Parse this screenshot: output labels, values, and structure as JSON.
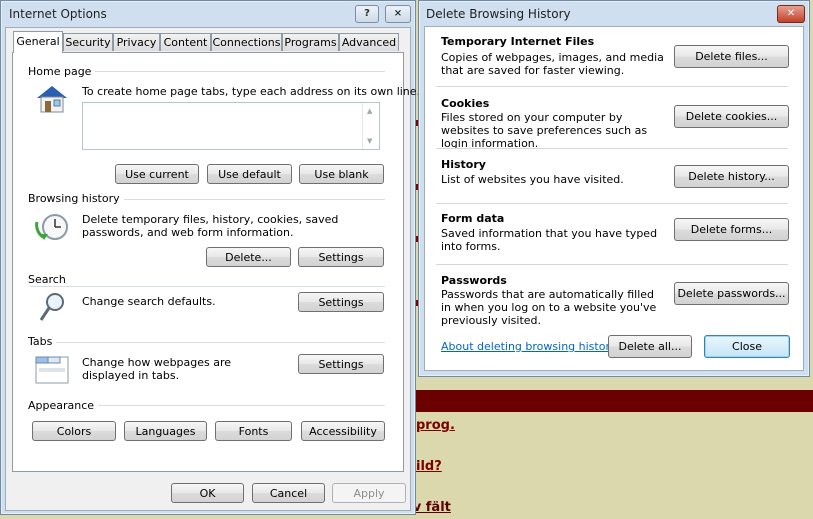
{
  "background": {
    "links": [
      "prog.",
      "ild?",
      "av fält"
    ]
  },
  "internet_options": {
    "title": "Internet Options",
    "help_glyph": "?",
    "close_glyph": "⨯",
    "tabs": [
      "General",
      "Security",
      "Privacy",
      "Content",
      "Connections",
      "Programs",
      "Advanced"
    ],
    "home_page": {
      "label": "Home page",
      "description": "To create home page tabs, type each address on its own line.",
      "value": "",
      "buttons": [
        "Use current",
        "Use default",
        "Use blank"
      ]
    },
    "browsing_history": {
      "label": "Browsing history",
      "description": "Delete temporary files, history, cookies, saved passwords, and web form information.",
      "delete_label": "Delete...",
      "settings_label": "Settings"
    },
    "search": {
      "label": "Search",
      "description": "Change search defaults.",
      "settings_label": "Settings"
    },
    "tabs_section": {
      "label": "Tabs",
      "description": "Change how webpages are displayed in tabs.",
      "settings_label": "Settings"
    },
    "appearance": {
      "label": "Appearance",
      "buttons": [
        "Colors",
        "Languages",
        "Fonts",
        "Accessibility"
      ]
    },
    "footer": {
      "ok": "OK",
      "cancel": "Cancel",
      "apply": "Apply"
    }
  },
  "delete_history": {
    "title": "Delete Browsing History",
    "close_glyph": "✕",
    "sections": [
      {
        "title": "Temporary Internet Files",
        "desc": "Copies of webpages, images, and media that are saved for faster viewing.",
        "button": "Delete files..."
      },
      {
        "title": "Cookies",
        "desc": "Files stored on your computer by websites to save preferences such as login information.",
        "button": "Delete cookies..."
      },
      {
        "title": "History",
        "desc": "List of websites you have visited.",
        "button": "Delete history..."
      },
      {
        "title": "Form data",
        "desc": "Saved information that you have typed into forms.",
        "button": "Delete forms..."
      },
      {
        "title": "Passwords",
        "desc": "Passwords that are automatically filled in when you log on to a website you've previously visited.",
        "button": "Delete passwords..."
      }
    ],
    "about_link": "About deleting browsing history",
    "delete_all": "Delete all...",
    "close": "Close"
  },
  "colors": {
    "title_bar": "#cfdfef",
    "link": "#0066cc",
    "background_bar": "#6a0000"
  }
}
